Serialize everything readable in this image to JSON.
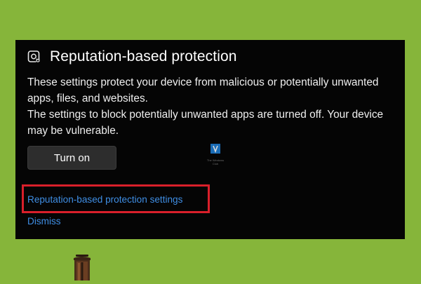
{
  "panel": {
    "title": "Reputation-based protection",
    "title_icon": "reputation-shield-icon",
    "description_line1": "These settings protect your device from malicious or potentially unwanted apps, files, and websites.",
    "description_line2": "The settings to block potentially unwanted apps are turned off. Your device may be vulnerable.",
    "turn_on_label": "Turn on",
    "settings_link_label": "Reputation-based protection settings",
    "dismiss_label": "Dismiss"
  },
  "watermark": {
    "icon": "thewindowsclub-logo-icon",
    "text_line1": "The Windows",
    "text_line2": "Club"
  },
  "colors": {
    "background": "#86b53a",
    "panel": "#050505",
    "link": "#3f8ee4",
    "highlight": "#d91f2a"
  }
}
